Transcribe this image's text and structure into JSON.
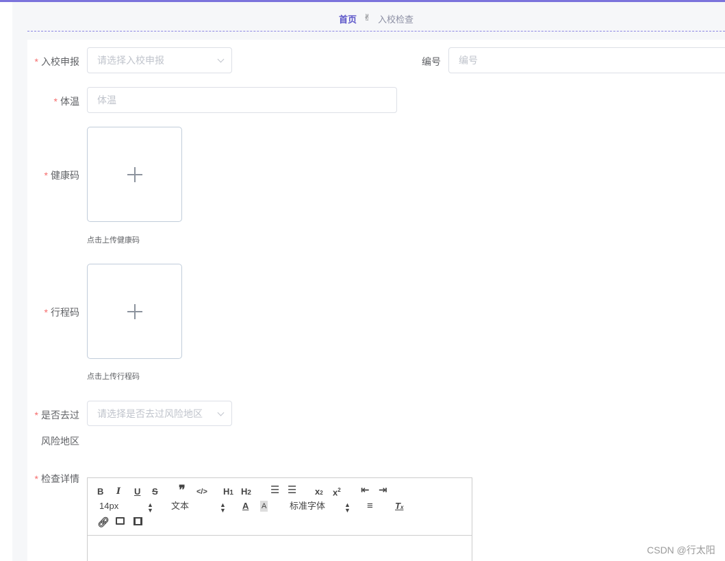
{
  "breadcrumb": {
    "home": "首页",
    "separator": "✌",
    "current": "入校检查"
  },
  "form": {
    "application": {
      "label": "入校申报",
      "placeholder": "请选择入校申报"
    },
    "number": {
      "label": "编号",
      "placeholder": "编号"
    },
    "temperature": {
      "label": "体温",
      "placeholder": "体温"
    },
    "health_code": {
      "label": "健康码",
      "tip": "点击上传健康码"
    },
    "trip_code": {
      "label": "行程码",
      "tip": "点击上传行程码"
    },
    "risk_area": {
      "label_line1": "是否去过",
      "label_line2": "风险地区",
      "placeholder": "请选择是否去过风险地区"
    },
    "details": {
      "label": "检查详情"
    },
    "required_mark": "*"
  },
  "editor": {
    "font_size": "14px",
    "header_select": "文本",
    "font_family": "标准字体"
  },
  "watermark": "CSDN @行太阳",
  "colors": {
    "accent": "#7b73dc",
    "required": "#f56c6c",
    "border": "#dcdfe6"
  }
}
